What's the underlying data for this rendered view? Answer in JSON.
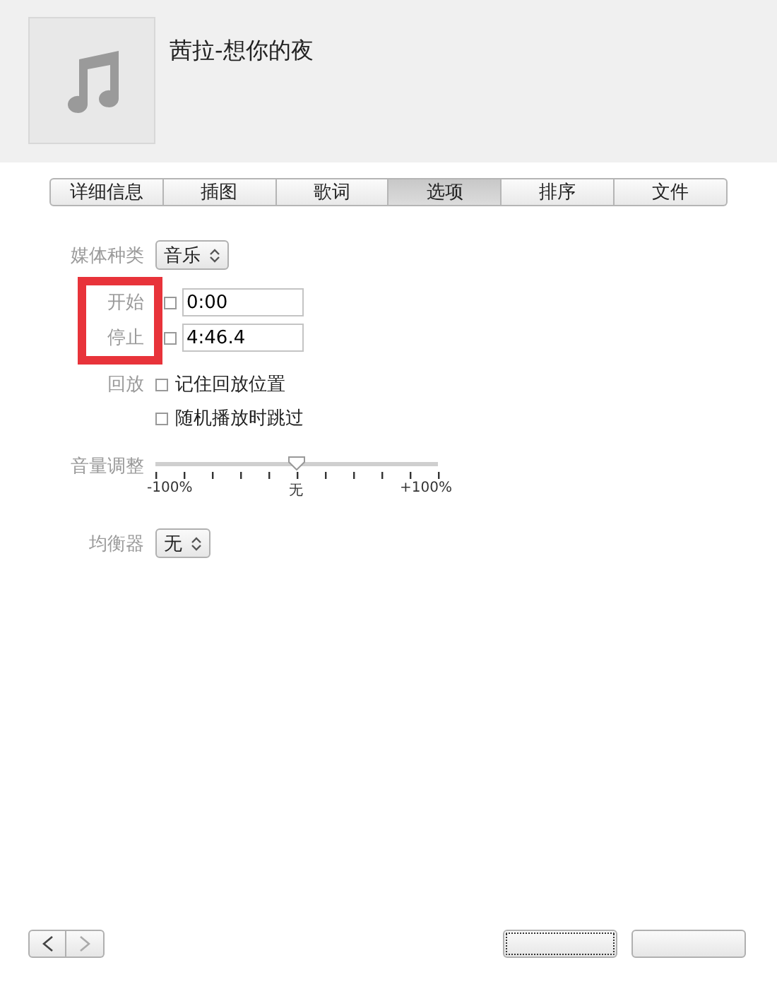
{
  "header": {
    "title": "茜拉-想你的夜",
    "artwork": {
      "kind": "placeholder"
    }
  },
  "tabs": [
    {
      "label": "详细信息",
      "selected": false
    },
    {
      "label": "插图",
      "selected": false
    },
    {
      "label": "歌词",
      "selected": false
    },
    {
      "label": "选项",
      "selected": true
    },
    {
      "label": "排序",
      "selected": false
    },
    {
      "label": "文件",
      "selected": false
    }
  ],
  "media_kind": {
    "label": "媒体种类",
    "value": "音乐"
  },
  "times": [
    {
      "label": "开始",
      "checked": false,
      "value": "0:00"
    },
    {
      "label": "停止",
      "checked": false,
      "value": "4:46.4"
    }
  ],
  "playback": {
    "label": "回放",
    "options": [
      {
        "label": "记住回放位置",
        "checked": false
      },
      {
        "label": "随机播放时跳过",
        "checked": false
      }
    ]
  },
  "volume": {
    "label": "音量调整",
    "level": 0.5,
    "min_label": "-100%",
    "mid_label": "无",
    "max_label": "+100%"
  },
  "equalizer": {
    "label": "均衡器",
    "value": "无"
  },
  "highlight": {
    "on": true
  }
}
